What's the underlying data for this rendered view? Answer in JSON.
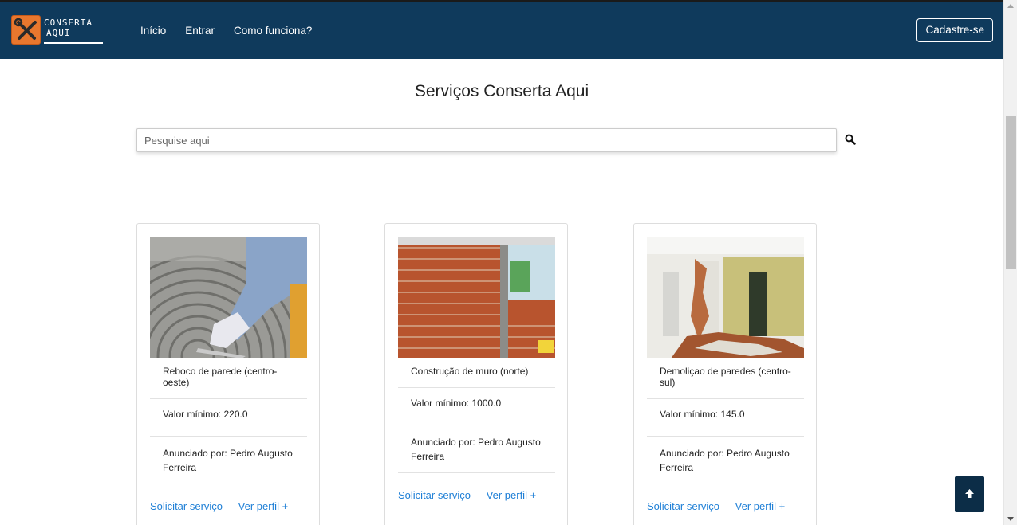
{
  "header": {
    "logo_line1": "CONSERTA",
    "logo_line2": "AQUI",
    "nav": [
      "Início",
      "Entrar",
      "Como funciona?"
    ],
    "signup_label": "Cadastre-se"
  },
  "main": {
    "title": "Serviços Conserta Aqui",
    "search_placeholder": "Pesquise aqui"
  },
  "cards": [
    {
      "title": "Reboco de parede (centro-oeste)",
      "price": "Valor mínimo: 220.0",
      "owner": "Anunciado por: Pedro Augusto Ferreira",
      "request_link": "Solicitar serviço",
      "profile_link": "Ver perfil +"
    },
    {
      "title": "Construção de muro (norte)",
      "price": "Valor mínimo: 1000.0",
      "owner": "Anunciado por: Pedro Augusto Ferreira",
      "request_link": "Solicitar serviço",
      "profile_link": "Ver perfil +"
    },
    {
      "title": "Demoliçao de paredes (centro-sul)",
      "price": "Valor mínimo: 145.0",
      "owner": "Anunciado por: Pedro Augusto Ferreira",
      "request_link": "Solicitar serviço",
      "profile_link": "Ver perfil +"
    }
  ],
  "colors": {
    "header_bg": "#0f3a5c",
    "logo_accent": "#e8772e",
    "link": "#1e7fd6",
    "to_top_bg": "#0c2d47"
  },
  "icons": [
    "wrench-screwdriver-icon",
    "search-icon",
    "arrow-up-icon"
  ]
}
